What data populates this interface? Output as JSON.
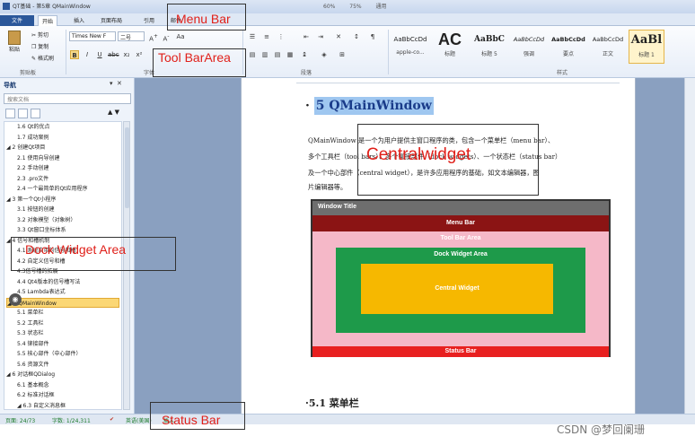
{
  "window": {
    "title": "QT基础 - 第5章 QMainWindow",
    "middle_status": [
      "60%",
      "75%",
      "通用"
    ]
  },
  "ribbon_tabs": [
    "文件",
    "开始",
    "插入",
    "页面布局",
    "引用",
    "邮件"
  ],
  "ribbon": {
    "clipboard": {
      "paste": "粘贴",
      "cut": "剪切",
      "copy": "复制",
      "format_painter": "格式刷",
      "group_label": "剪贴板"
    },
    "font": {
      "name": "Times New F",
      "size": "二号",
      "group_label": "字体"
    },
    "paragraph": {
      "group_label": "段落"
    },
    "styles": {
      "group_label": "样式",
      "items": [
        {
          "preview": "AaBbCcDd",
          "name": "apple-co..."
        },
        {
          "preview": "AC",
          "name": "标题"
        },
        {
          "preview": "AaBbC",
          "name": "标题 5"
        },
        {
          "preview": "AaBbCcDd",
          "name": "强调"
        },
        {
          "preview": "AaBbCcDd",
          "name": "要点"
        },
        {
          "preview": "AaBbCcDd",
          "name": "正文"
        },
        {
          "preview": "AaBl",
          "name": "标题 1"
        }
      ]
    }
  },
  "nav": {
    "title": "导航",
    "search_placeholder": "搜索文档",
    "items": [
      {
        "label": "1.6 Qt的优点",
        "level": 2
      },
      {
        "label": "1.7 成功案例",
        "level": 2
      },
      {
        "label": "◢ 2 创建Qt项目",
        "level": 1
      },
      {
        "label": "2.1 使用向导创建",
        "level": 2
      },
      {
        "label": "2.2 手动创建",
        "level": 2
      },
      {
        "label": "2.3 .pro文件",
        "level": 2
      },
      {
        "label": "2.4 一个最简单的Qt应用程序",
        "level": 2
      },
      {
        "label": "◢ 3 第一个Qt小程序",
        "level": 1
      },
      {
        "label": "3.1 按钮的创建",
        "level": 2
      },
      {
        "label": "3.2 对象模型（对象树）",
        "level": 2
      },
      {
        "label": "3.3 Qt窗口坐标体系",
        "level": 2
      },
      {
        "label": "◢ 4 信号和槽机制",
        "level": 1
      },
      {
        "label": "4.1 系统自带的信号和槽",
        "level": 2
      },
      {
        "label": "4.2 自定义信号和槽",
        "level": 2
      },
      {
        "label": "4.3信号槽的拓展",
        "level": 2
      },
      {
        "label": "4.4 Qt4版本的信号槽写法",
        "level": 2
      },
      {
        "label": "4.5 Lambda表达式",
        "level": 2
      },
      {
        "label": "◢ 5 QMainWindow",
        "level": 1,
        "selected": true
      },
      {
        "label": "5.1 菜单栏",
        "level": 2
      },
      {
        "label": "5.2 工具栏",
        "level": 2
      },
      {
        "label": "5.3 状态栏",
        "level": 2
      },
      {
        "label": "5.4 铆接部件",
        "level": 2
      },
      {
        "label": "5.5 核心部件（中心部件）",
        "level": 2
      },
      {
        "label": "5.6 资源文件",
        "level": 2
      },
      {
        "label": "◢ 6 对话框QDialog",
        "level": 1
      },
      {
        "label": "6.1 基本概念",
        "level": 2
      },
      {
        "label": "6.2 标准对话框",
        "level": 2
      },
      {
        "label": "◢ 6.3 自定义消息框",
        "level": 2
      }
    ]
  },
  "document": {
    "heading": "5 QMainWindow",
    "heading_prefix": "·",
    "paragraph_lines": [
      "QMainWindow 是一个为用户提供主窗口程序的类，包含一个菜单栏（menu bar）、",
      "多个工具栏（tool bars）、多个铆接部件（dock widgets）、一个状态栏（status bar）",
      "及一个中心部件（central widget），是许多应用程序的基础，如文本编辑器，图",
      "片编辑器等。"
    ],
    "diagram": {
      "window_title": "Window Title",
      "menu_bar": "Menu Bar",
      "tool_bar_area": "Tool Bar Area",
      "dock_widget_area": "Dock Widget Area",
      "central_widget": "Central Widget",
      "status_bar": "Status Bar",
      "colors": {
        "title": "#6e6e6e",
        "menu": "#8b1414",
        "toolbar": "#f5b8c8",
        "dock": "#1e9a4a",
        "central": "#f6b800",
        "status": "#e82020"
      }
    },
    "next_heading": "·5.1 菜单栏"
  },
  "status_bar": {
    "page": "页面: 24/73",
    "words": "字数: 1/24,311",
    "language": "英语(美国)",
    "mode": "插入"
  },
  "annotations": {
    "menu_bar": "Menu Bar",
    "tool_bar_area": "Tool BarArea",
    "central_widget": "Centralwidget",
    "dock_widget_area": "Dock Widget Area",
    "status_bar": "Status Bar",
    "color": "#e0201a"
  },
  "watermark": "CSDN @梦回阑珊"
}
